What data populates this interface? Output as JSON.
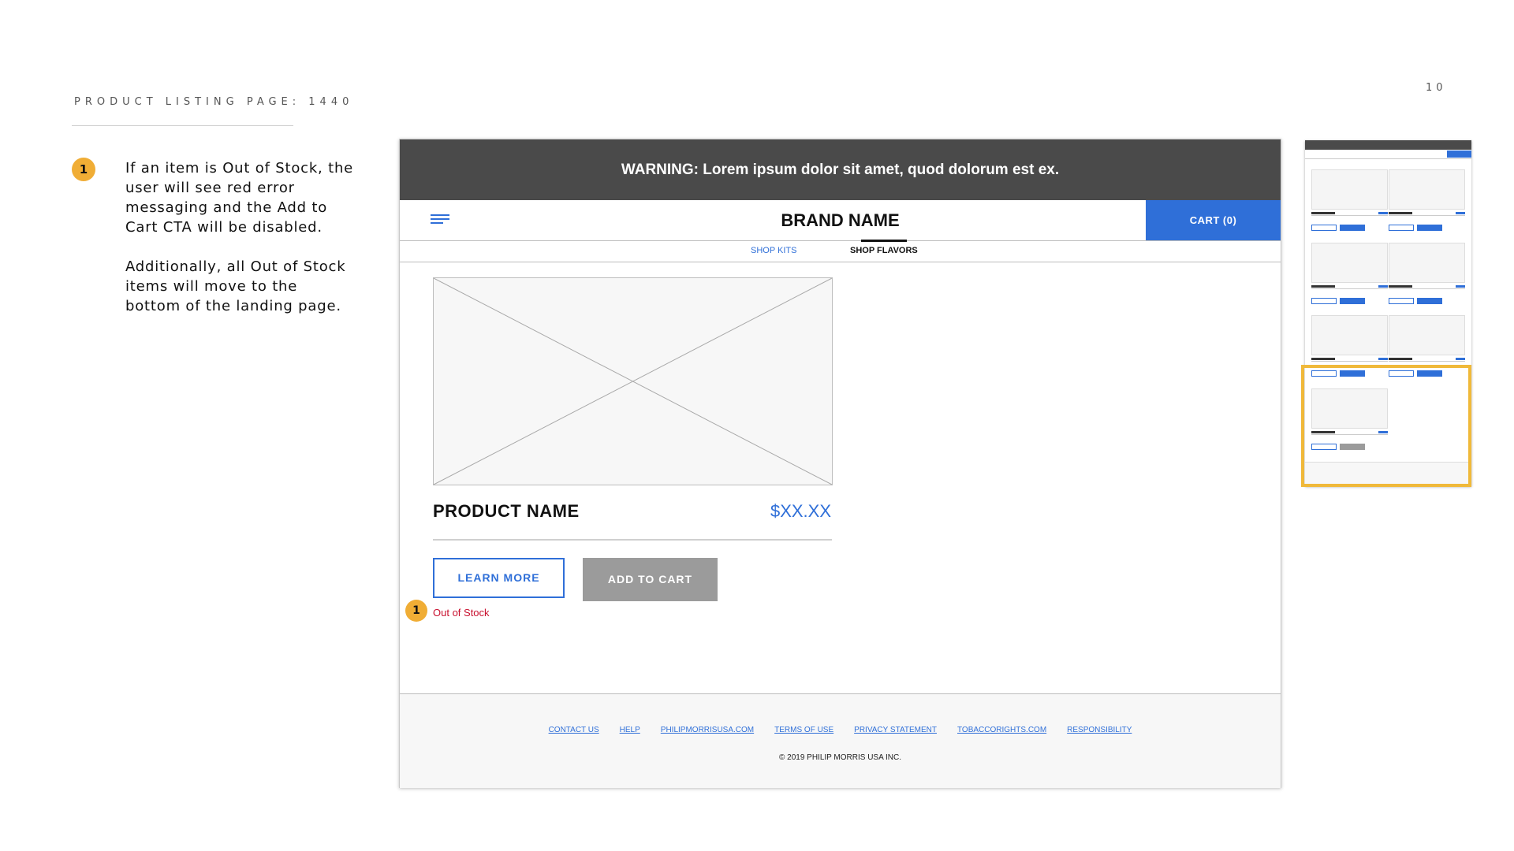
{
  "slide": {
    "title": "PRODUCT LISTING PAGE: 1440",
    "page_number": "10",
    "note": {
      "badge": "1",
      "paragraph1": "If an item is Out of Stock, the user will see red error messaging and the Add to Cart CTA will be disabled.",
      "paragraph2": "Additionally, all Out of Stock items will move to the bottom of the landing page."
    }
  },
  "wireframe": {
    "warning": "WARNING: Lorem ipsum dolor sit amet, quod dolorum est ex.",
    "brand": "BRAND NAME",
    "cart": "CART (0)",
    "nav": {
      "kits": "SHOP KITS",
      "flavors": "SHOP FLAVORS"
    },
    "product": {
      "name": "PRODUCT NAME",
      "price": "$XX.XX",
      "learn_more": "LEARN MORE",
      "add_to_cart": "ADD TO CART",
      "badge": "1",
      "status": "Out of Stock"
    },
    "footer": {
      "links": [
        "CONTACT US",
        "HELP",
        "PHILIPMORRISUSA.COM",
        "TERMS OF USE",
        "PRIVACY STATEMENT",
        "TOBACCORIGHTS.COM",
        "RESPONSIBILITY"
      ],
      "copyright": "© 2019 PHILIP MORRIS USA INC."
    }
  },
  "colors": {
    "accent_blue": "#2f6fd8",
    "warning_bg": "#4a4a4a",
    "badge": "#f0ad35",
    "highlight": "#f0b93a",
    "error": "#c8102e",
    "disabled": "#9b9b9b"
  },
  "icons": {
    "menu": "hamburger-menu-icon"
  }
}
